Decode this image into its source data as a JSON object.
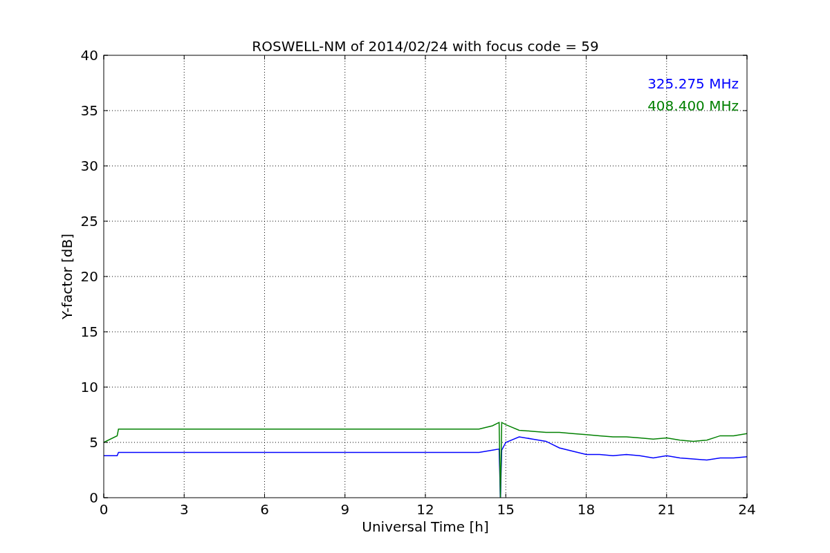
{
  "chart_data": {
    "type": "line",
    "title": "ROSWELL-NM of 2014/02/24 with focus code = 59",
    "xlabel": "Universal Time [h]",
    "ylabel": "Y-factor [dB]",
    "x": [
      0,
      0.5,
      0.55,
      14,
      14.5,
      14.75,
      14.8,
      14.85,
      15,
      15.5,
      16,
      16.5,
      17,
      17.5,
      18,
      18.5,
      19,
      19.5,
      20,
      20.5,
      21,
      21.5,
      22,
      22.5,
      23,
      23.5,
      24
    ],
    "series": [
      {
        "name": "325.275 MHz",
        "color": "#0000ff",
        "values": [
          3.8,
          3.8,
          4.1,
          4.1,
          4.3,
          4.4,
          0,
          4.3,
          5.0,
          5.5,
          5.3,
          5.1,
          4.5,
          4.2,
          3.9,
          3.9,
          3.8,
          3.9,
          3.8,
          3.6,
          3.8,
          3.6,
          3.5,
          3.4,
          3.6,
          3.6,
          3.7
        ]
      },
      {
        "name": "408.400 MHz",
        "color": "#008000",
        "values": [
          5.0,
          5.6,
          6.2,
          6.2,
          6.5,
          6.8,
          0,
          6.8,
          6.6,
          6.1,
          6.0,
          5.9,
          5.9,
          5.8,
          5.7,
          5.6,
          5.5,
          5.5,
          5.4,
          5.3,
          5.4,
          5.2,
          5.1,
          5.2,
          5.6,
          5.6,
          5.8
        ]
      }
    ],
    "xlim": [
      0,
      24
    ],
    "ylim": [
      0,
      40
    ],
    "xticks": [
      0,
      3,
      6,
      9,
      12,
      15,
      18,
      21,
      24
    ],
    "yticks": [
      0,
      5,
      10,
      15,
      20,
      25,
      30,
      35,
      40
    ],
    "grid": true
  }
}
